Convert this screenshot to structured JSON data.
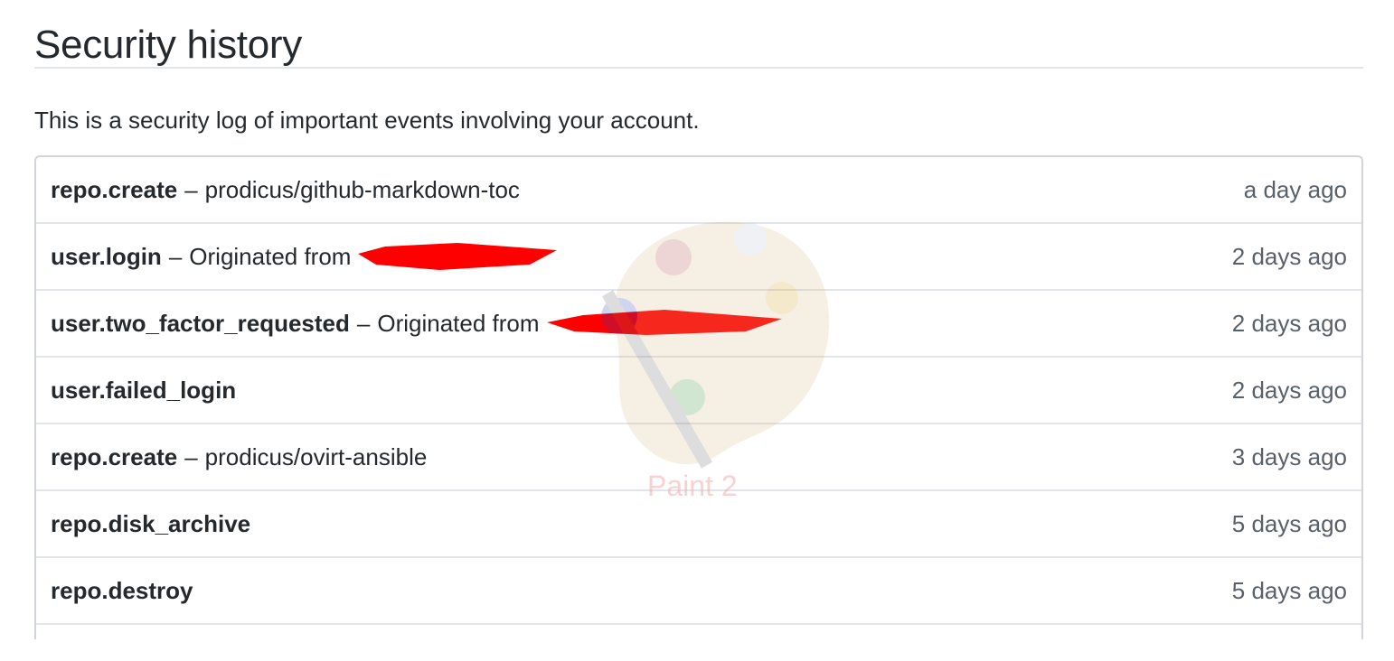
{
  "page": {
    "title": "Security history",
    "description": "This is a security log of important events involving your account."
  },
  "log": {
    "rows": [
      {
        "action": "repo.create",
        "separator": "–",
        "detail": "prodicus/github-markdown-toc",
        "redacted": false,
        "time": "a day ago"
      },
      {
        "action": "user.login",
        "separator": "–",
        "detail": "Originated from",
        "redacted": true,
        "time": "2 days ago"
      },
      {
        "action": "user.two_factor_requested",
        "separator": "–",
        "detail": "Originated from",
        "redacted": true,
        "time": "2 days ago"
      },
      {
        "action": "user.failed_login",
        "separator": "",
        "detail": "",
        "redacted": false,
        "time": "2 days ago"
      },
      {
        "action": "repo.create",
        "separator": "–",
        "detail": "prodicus/ovirt-ansible",
        "redacted": false,
        "time": "3 days ago"
      },
      {
        "action": "repo.disk_archive",
        "separator": "",
        "detail": "",
        "redacted": false,
        "time": "5 days ago"
      },
      {
        "action": "repo.destroy",
        "separator": "",
        "detail": "",
        "redacted": false,
        "time": "5 days ago"
      },
      {
        "action": "",
        "separator": "",
        "detail": "",
        "redacted": false,
        "time": ""
      }
    ]
  },
  "overlay": {
    "watermark_label": "Paint 2",
    "watermark_icon": "paint-palette-icon",
    "redaction_color": "#ff0000"
  },
  "colors": {
    "text": "#24292e",
    "muted": "#586069",
    "border": "#e1e4e8"
  }
}
